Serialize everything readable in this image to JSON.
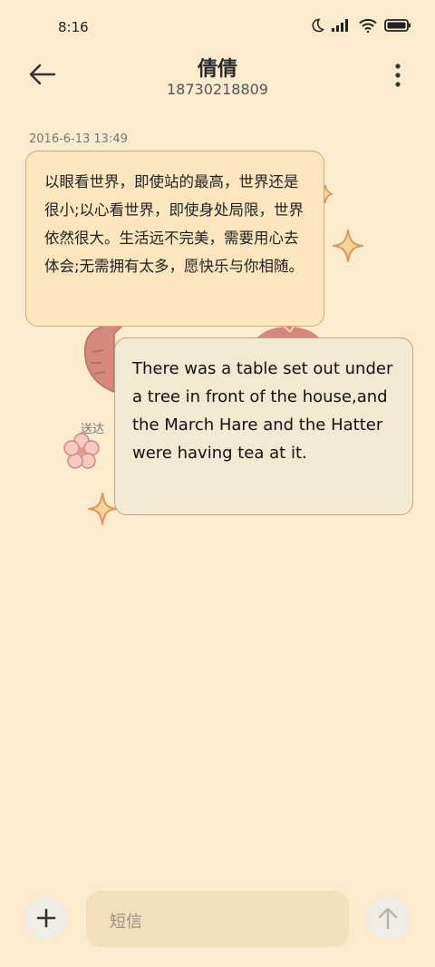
{
  "status_bar": {
    "time": "8:16"
  },
  "header": {
    "contact_name": "倩倩",
    "phone_number": "18730218809"
  },
  "conversation": {
    "timestamp": "2016-6-13 13:49",
    "messages": [
      {
        "direction": "incoming",
        "text": "以眼看世界，即使站的最高，世界还是很小;以心看世界，即使身处局限，世界依然很大。生活远不完美，需要用心去体会;无需拥有太多，愿快乐与你相随。"
      },
      {
        "direction": "outgoing",
        "text": "There was a table set out under a tree in front of the house,and the March Hare and the Hatter were having tea at it.",
        "status": "送达"
      }
    ]
  },
  "composer": {
    "placeholder": "短信"
  },
  "colors": {
    "background": "#fdebcd",
    "incoming_bubble": "#fde6bd",
    "outgoing_bubble": "#f3e9d2"
  },
  "icons": [
    "moon-icon",
    "signal-icon",
    "wifi-icon",
    "battery-icon",
    "back-arrow-icon",
    "more-icon",
    "plus-icon",
    "send-arrow-icon",
    "flower-icon",
    "sparkle-icon"
  ]
}
